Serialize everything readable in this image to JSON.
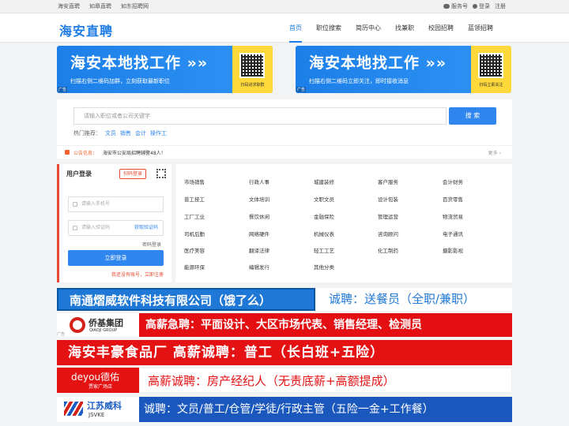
{
  "topbar": {
    "links": [
      "海安直聘",
      "如皋直聘",
      "如东招聘网"
    ],
    "service": "服务号",
    "login": "登录",
    "register": "注册"
  },
  "header": {
    "logo": "海安直聘",
    "nav": [
      "首页",
      "职位搜索",
      "简历中心",
      "找兼职",
      "校园招聘",
      "蓝领招聘"
    ],
    "active_index": 0
  },
  "banners": [
    {
      "title": "海安本地找工作 »»",
      "sub": "扫描右侧二维码加群，立刻获取最新职位",
      "qr_label": "扫码进求职群",
      "ad": "广告"
    },
    {
      "title": "海安本地找工作 »»",
      "sub": "扫描右侧二维码立即关注，即时接收消息",
      "qr_label": "扫码立即关注",
      "ad": "广告"
    }
  ],
  "search": {
    "placeholder": "请输入职位或者公司关键字",
    "button": "搜 索",
    "hot_label": "热门推荐：",
    "hot": [
      "文员",
      "销售",
      "会计",
      "操作工"
    ]
  },
  "notice": {
    "label": "公告信息：",
    "text": "海安市公安局招聘辅警48人！",
    "more": "更多 ›"
  },
  "login": {
    "title": "用户登录",
    "scan": "扫码登录",
    "phone_placeholder": "请输入手机号",
    "code_placeholder": "请输入验证码",
    "get_code": "获取验证码",
    "password_login": "密码登录",
    "submit": "立即登录",
    "register_hint": "我还没有账号，立即注册"
  },
  "categories": [
    [
      "市场销售",
      "行政人事",
      "城建装修",
      "客户服务",
      "会计财务"
    ],
    [
      "普工技工",
      "文体培训",
      "文职文员",
      "设计包装",
      "百货零售"
    ],
    [
      "工厂工业",
      "餐饮休闲",
      "金融保险",
      "管理运营",
      "物流贸易"
    ],
    [
      "司机后勤",
      "网络硬件",
      "机械仪表",
      "咨询顾问",
      "电子通讯"
    ],
    [
      "医疗美容",
      "翻译法律",
      "轻工工艺",
      "化工制药",
      "摄影影视"
    ],
    [
      "能源环保",
      "编辑发行",
      "其他分类"
    ]
  ],
  "ads": {
    "ad1_left": "南通熠威软件科技有限公司（饿了么）",
    "ad1_right": "诚聘：送餐员（全职/兼职）",
    "ad2_logo": "侨基集团",
    "ad2_logo_en": "QIAOJI GROUP",
    "ad2_text": "高薪急聘：平面设计、大区市场代表、销售经理、检测员",
    "ad3_text": "海安丰豪食品厂 高薪诚聘：普工（长白班+五险）",
    "ad4_logo": "deyou德佑",
    "ad4_logo_sub": "贾家广场店",
    "ad4_text": "高薪诚聘：房产经纪人（无责底薪+高额提成）",
    "ad5_logo": "江苏威科",
    "ad5_logo_en": "JSVKE",
    "ad5_text": "诚聘：文员/普工/仓管/学徒/行政主管（五险一金+工作餐）",
    "ad_tag": "广告"
  }
}
